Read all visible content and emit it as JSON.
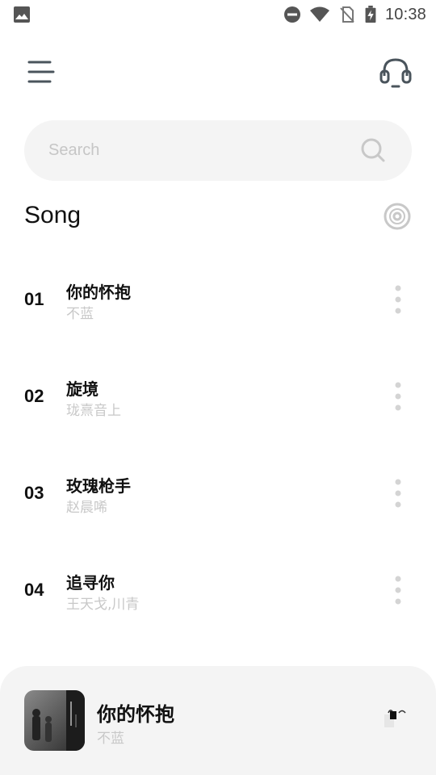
{
  "status_bar": {
    "time": "10:38",
    "icons": [
      "gallery-icon",
      "do-not-disturb-icon",
      "wifi-icon",
      "no-sim-icon",
      "battery-charging-icon"
    ]
  },
  "header": {
    "menu_icon": "hamburger-menu-icon",
    "right_icon": "headphones-icon"
  },
  "search": {
    "placeholder": "Search",
    "icon": "search-icon"
  },
  "section": {
    "title": "Song",
    "icon": "vinyl-disc-icon"
  },
  "songs": [
    {
      "number": "01",
      "title": "你的怀抱",
      "artist": "不蓝"
    },
    {
      "number": "02",
      "title": "旋境",
      "artist": "珑熹音上"
    },
    {
      "number": "03",
      "title": "玫瑰枪手",
      "artist": "赵晨唏"
    },
    {
      "number": "04",
      "title": "追寻你",
      "artist": "王天戈,川青"
    }
  ],
  "now_playing": {
    "title": "你的怀抱",
    "artist": "不蓝",
    "cover_icon": "album-cover",
    "control_icon": "play-control-icon"
  },
  "colors": {
    "background": "#ffffff",
    "panel": "#f4f4f4",
    "primary_text": "#111111",
    "secondary_text": "#c8c8c8",
    "icon": "#4a545c"
  }
}
